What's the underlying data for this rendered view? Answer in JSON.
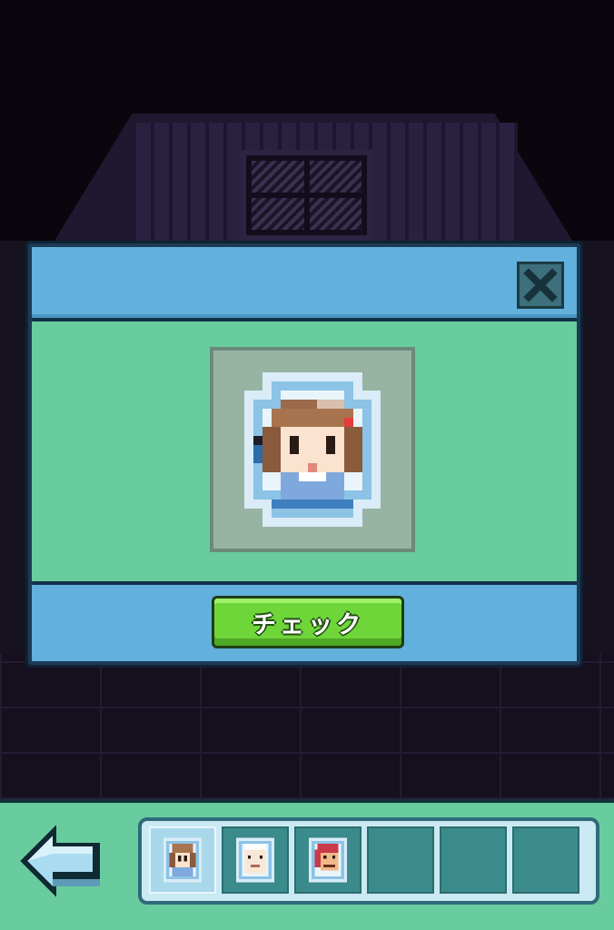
{
  "popup": {
    "check_label": "チェック",
    "close_icon": "close-x-icon",
    "item_icon": "girl-portrait-medallion"
  },
  "inventory": {
    "slots": [
      {
        "item": "girl-portrait-medallion",
        "selected": true
      },
      {
        "item": "old-man-portrait-medallion",
        "selected": false
      },
      {
        "item": "red-hair-portrait-medallion",
        "selected": false
      },
      {
        "item": "",
        "selected": false
      },
      {
        "item": "",
        "selected": false
      },
      {
        "item": "",
        "selected": false
      }
    ]
  },
  "navigation": {
    "back_icon": "back-arrow-icon"
  },
  "colors": {
    "panel_blue": "#62b0dc",
    "panel_green": "#69cc9e",
    "button_green": "#6fd63a",
    "slot_teal": "#3b8b8c"
  }
}
